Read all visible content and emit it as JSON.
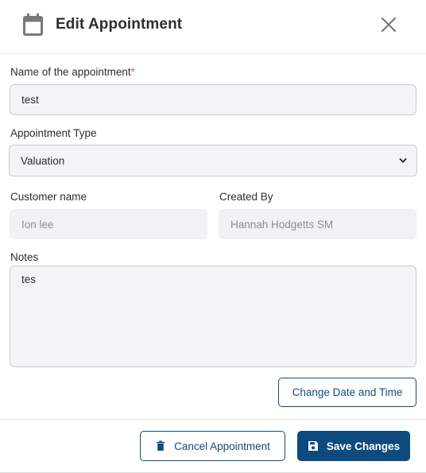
{
  "header": {
    "title": "Edit Appointment",
    "icon": "calendar-icon",
    "close_icon": "close-icon"
  },
  "form": {
    "name_label": "Name of the appointment",
    "name_required_mark": "*",
    "name_value": "test",
    "type_label": "Appointment Type",
    "type_value": "Valuation",
    "customer_label": "Customer name",
    "customer_value": "Ion lee",
    "created_by_label": "Created By",
    "created_by_value": "Hannah Hodgetts SM",
    "notes_label": "Notes",
    "notes_value": "tes"
  },
  "actions": {
    "change_date_label": "Change Date and Time",
    "cancel_label": "Cancel Appointment",
    "cancel_icon": "trash-icon",
    "save_label": "Save Changes",
    "save_icon": "floppy-disk-icon"
  },
  "colors": {
    "accent": "#0d4a7d",
    "required": "#d9534f",
    "field_bg": "#f3f4f6",
    "icon_gray": "#75787d"
  }
}
